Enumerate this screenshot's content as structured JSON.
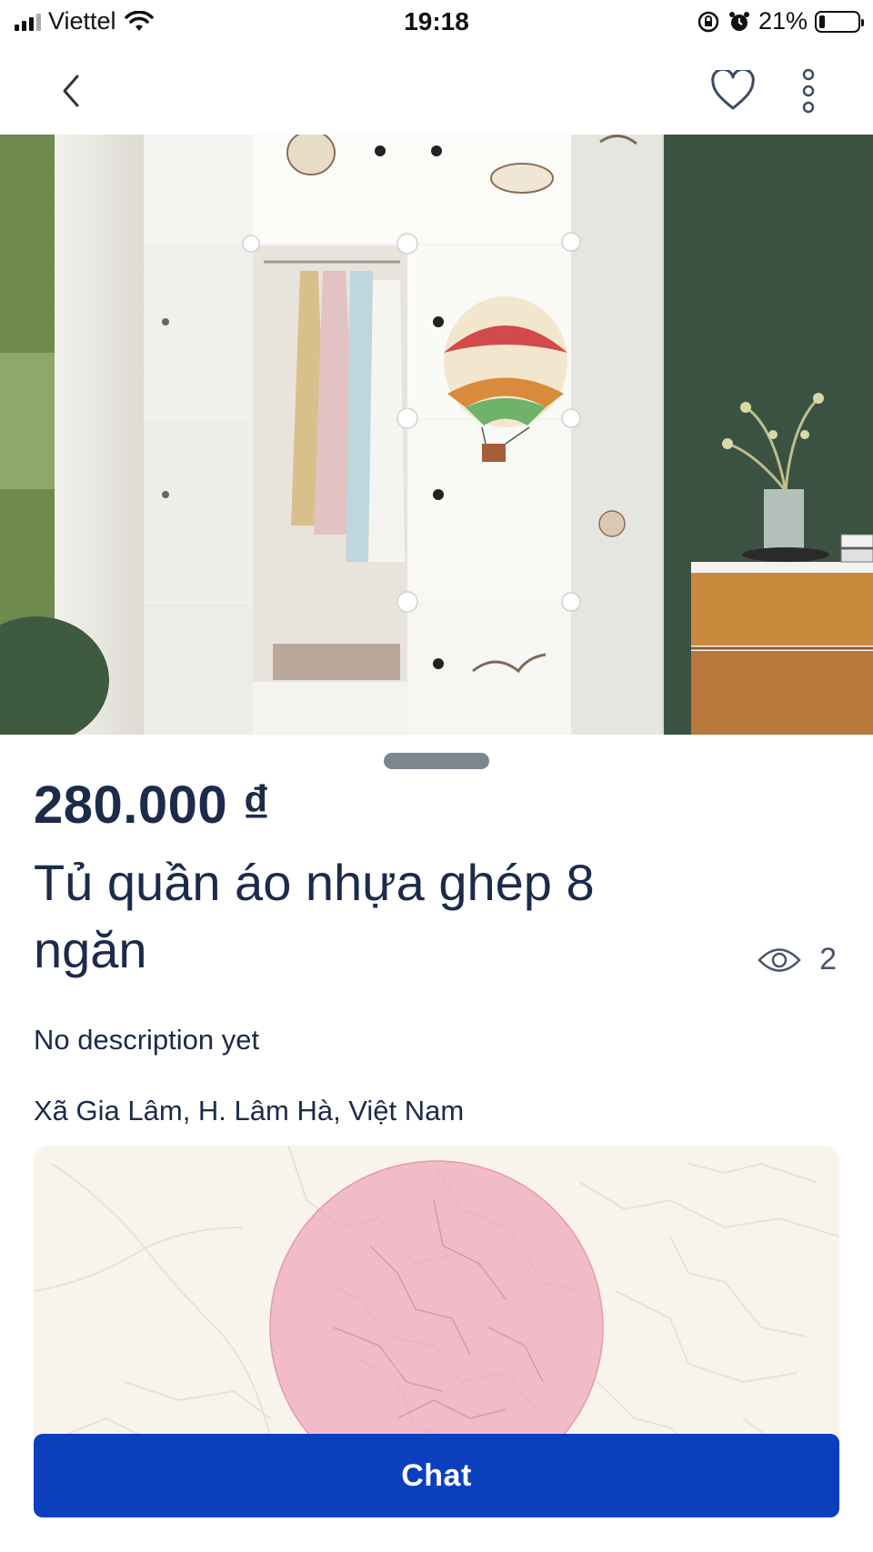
{
  "status_bar": {
    "carrier": "Viettel",
    "time": "19:18",
    "battery": "21%"
  },
  "nav": {
    "back_icon": "chevron-left-icon",
    "favorite_icon": "heart-outline-icon",
    "more_icon": "more-vertical-icon"
  },
  "listing": {
    "price": "280.000 ₫",
    "title": "Tủ quần áo nhựa ghép 8 ngăn",
    "views": "2",
    "description": "No description yet",
    "location": "Xã Gia Lâm, H. Lâm Hà, Việt Nam"
  },
  "actions": {
    "chat_label": "Chat"
  },
  "colors": {
    "primary": "#0c3fbd",
    "text": "#1c2b4a",
    "map_circle": "#f0a8bd"
  }
}
